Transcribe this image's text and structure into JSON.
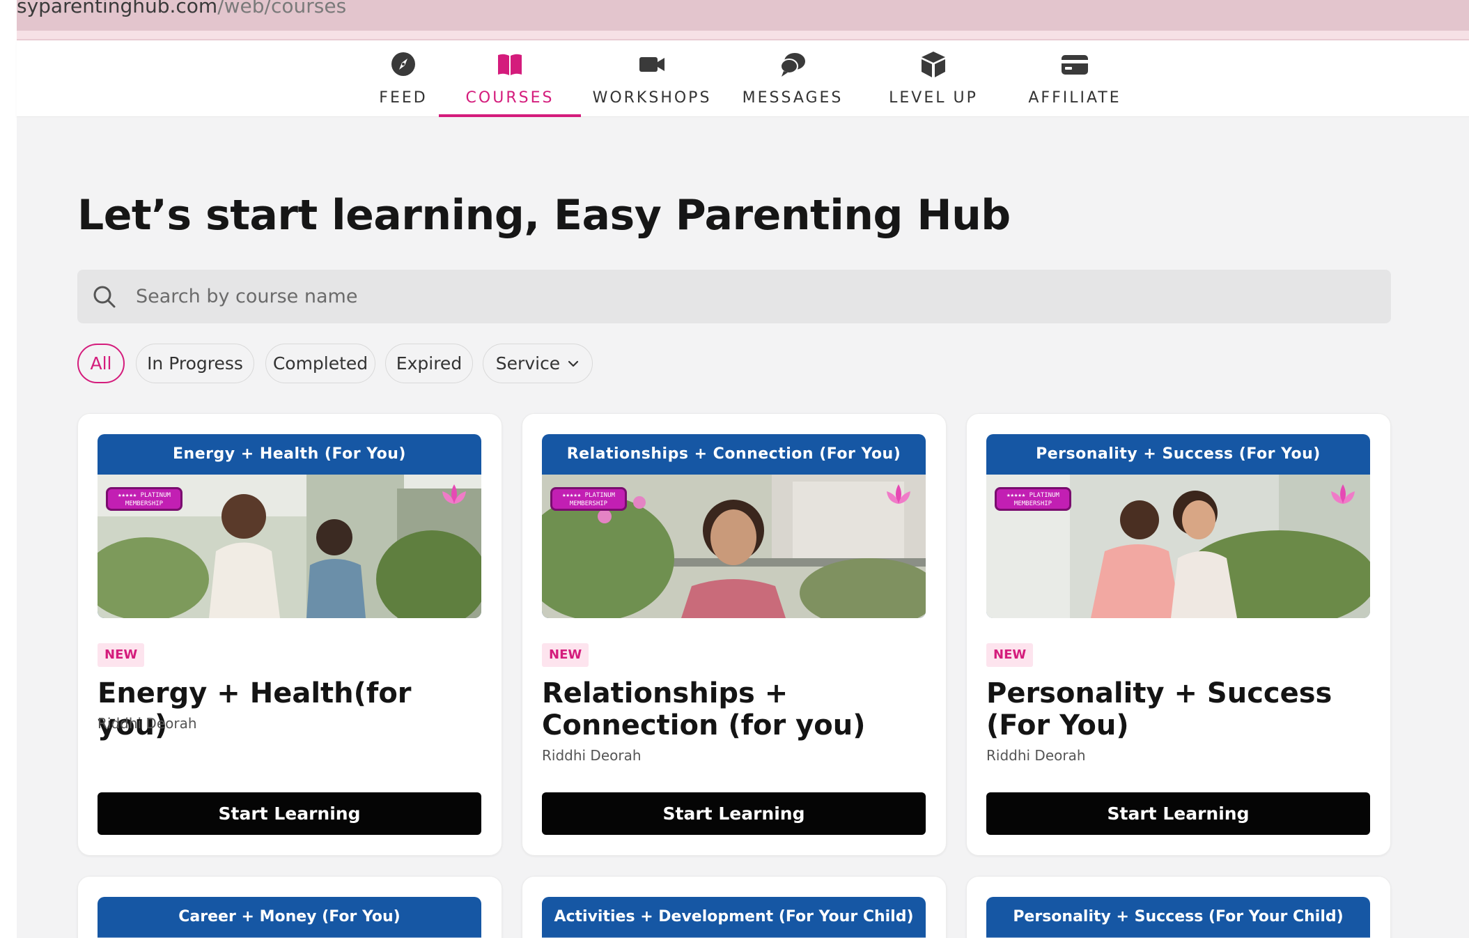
{
  "browser": {
    "url_host": "syparentinghub.com",
    "url_path": "/web/courses"
  },
  "nav": {
    "items": [
      {
        "label": "FEED",
        "icon": "compass-icon"
      },
      {
        "label": "COURSES",
        "icon": "book-icon",
        "active": true
      },
      {
        "label": "WORKSHOPS",
        "icon": "video-camera-icon"
      },
      {
        "label": "MESSAGES",
        "icon": "chat-bubbles-icon"
      },
      {
        "label": "LEVEL UP",
        "icon": "cube-icon"
      },
      {
        "label": "AFFILIATE",
        "icon": "wallet-icon"
      }
    ]
  },
  "page": {
    "heading": "Let’s start learning, Easy Parenting Hub"
  },
  "search": {
    "placeholder": "Search by course name",
    "value": ""
  },
  "filters": {
    "chips": [
      {
        "label": "All",
        "active": true
      },
      {
        "label": "In Progress"
      },
      {
        "label": "Completed"
      },
      {
        "label": "Expired"
      },
      {
        "label": "Service",
        "dropdown": true
      }
    ]
  },
  "courses": [
    {
      "banner_title": "Energy + Health (For You)",
      "badge": "★★★★★ PLATINUM MEMBERSHIP",
      "tag": "NEW",
      "title": "Energy + Health(for you)",
      "author": "Riddhi Deorah",
      "cta": "Start Learning"
    },
    {
      "banner_title": "Relationships + Connection  (For You)",
      "badge": "★★★★★ PLATINUM MEMBERSHIP",
      "tag": "NEW",
      "title": "Relationships + Connection (for you)",
      "author": "Riddhi Deorah",
      "cta": "Start Learning"
    },
    {
      "banner_title": "Personality + Success  (For You)",
      "badge": "★★★★★ PLATINUM MEMBERSHIP",
      "tag": "NEW",
      "title": "Personality + Success (For You)",
      "author": "Riddhi Deorah",
      "cta": "Start Learning"
    },
    {
      "banner_title": "Career + Money (For You)"
    },
    {
      "banner_title": "Activities + Development (For Your Child)"
    },
    {
      "banner_title": "Personality + Success (For Your Child)"
    }
  ],
  "colors": {
    "accent": "#d41c7c",
    "banner_blue": "#1657a4",
    "page_bg": "#f3f3f4",
    "button_black": "#050505"
  }
}
